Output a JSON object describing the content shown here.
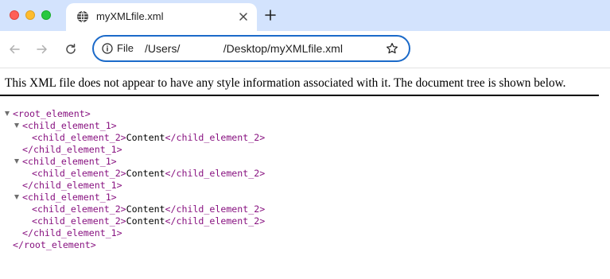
{
  "browser": {
    "tab": {
      "title": "myXMLfile.xml"
    },
    "new_tab_label": "+",
    "address": {
      "chip_label": "File",
      "url_text": "/Users/              /Desktop/myXMLfile.xml"
    }
  },
  "page": {
    "header_text": "This XML file does not appear to have any style information associated with it. The document tree is shown below.",
    "tree": {
      "root_open": "<root_element>",
      "root_close": "</root_element>",
      "groups": [
        {
          "open": "<child_element_1>",
          "children": [
            {
              "open": "<child_element_2>",
              "content": "Content",
              "close": "</child_element_2>"
            }
          ],
          "close": "</child_element_1>"
        },
        {
          "open": "<child_element_1>",
          "children": [
            {
              "open": "<child_element_2>",
              "content": "Content",
              "close": "</child_element_2>"
            }
          ],
          "close": "</child_element_1>"
        },
        {
          "open": "<child_element_1>",
          "children": [
            {
              "open": "<child_element_2>",
              "content": "Content",
              "close": "</child_element_2>"
            },
            {
              "open": "<child_element_2>",
              "content": "Content",
              "close": "</child_element_2>"
            }
          ],
          "close": "</child_element_1>"
        }
      ]
    }
  },
  "colors": {
    "tag": "#881280",
    "text": "#000000",
    "omnibox_border": "#1b6ac9",
    "tabstrip": "#d3e3fd"
  },
  "icons": {
    "favicon": "globe-icon",
    "tab_close": "close-icon",
    "back": "arrow-left-icon",
    "forward": "arrow-right-icon",
    "reload": "reload-icon",
    "site_info": "info-icon",
    "bookmark": "star-icon",
    "expand": "triangle-down-icon"
  }
}
